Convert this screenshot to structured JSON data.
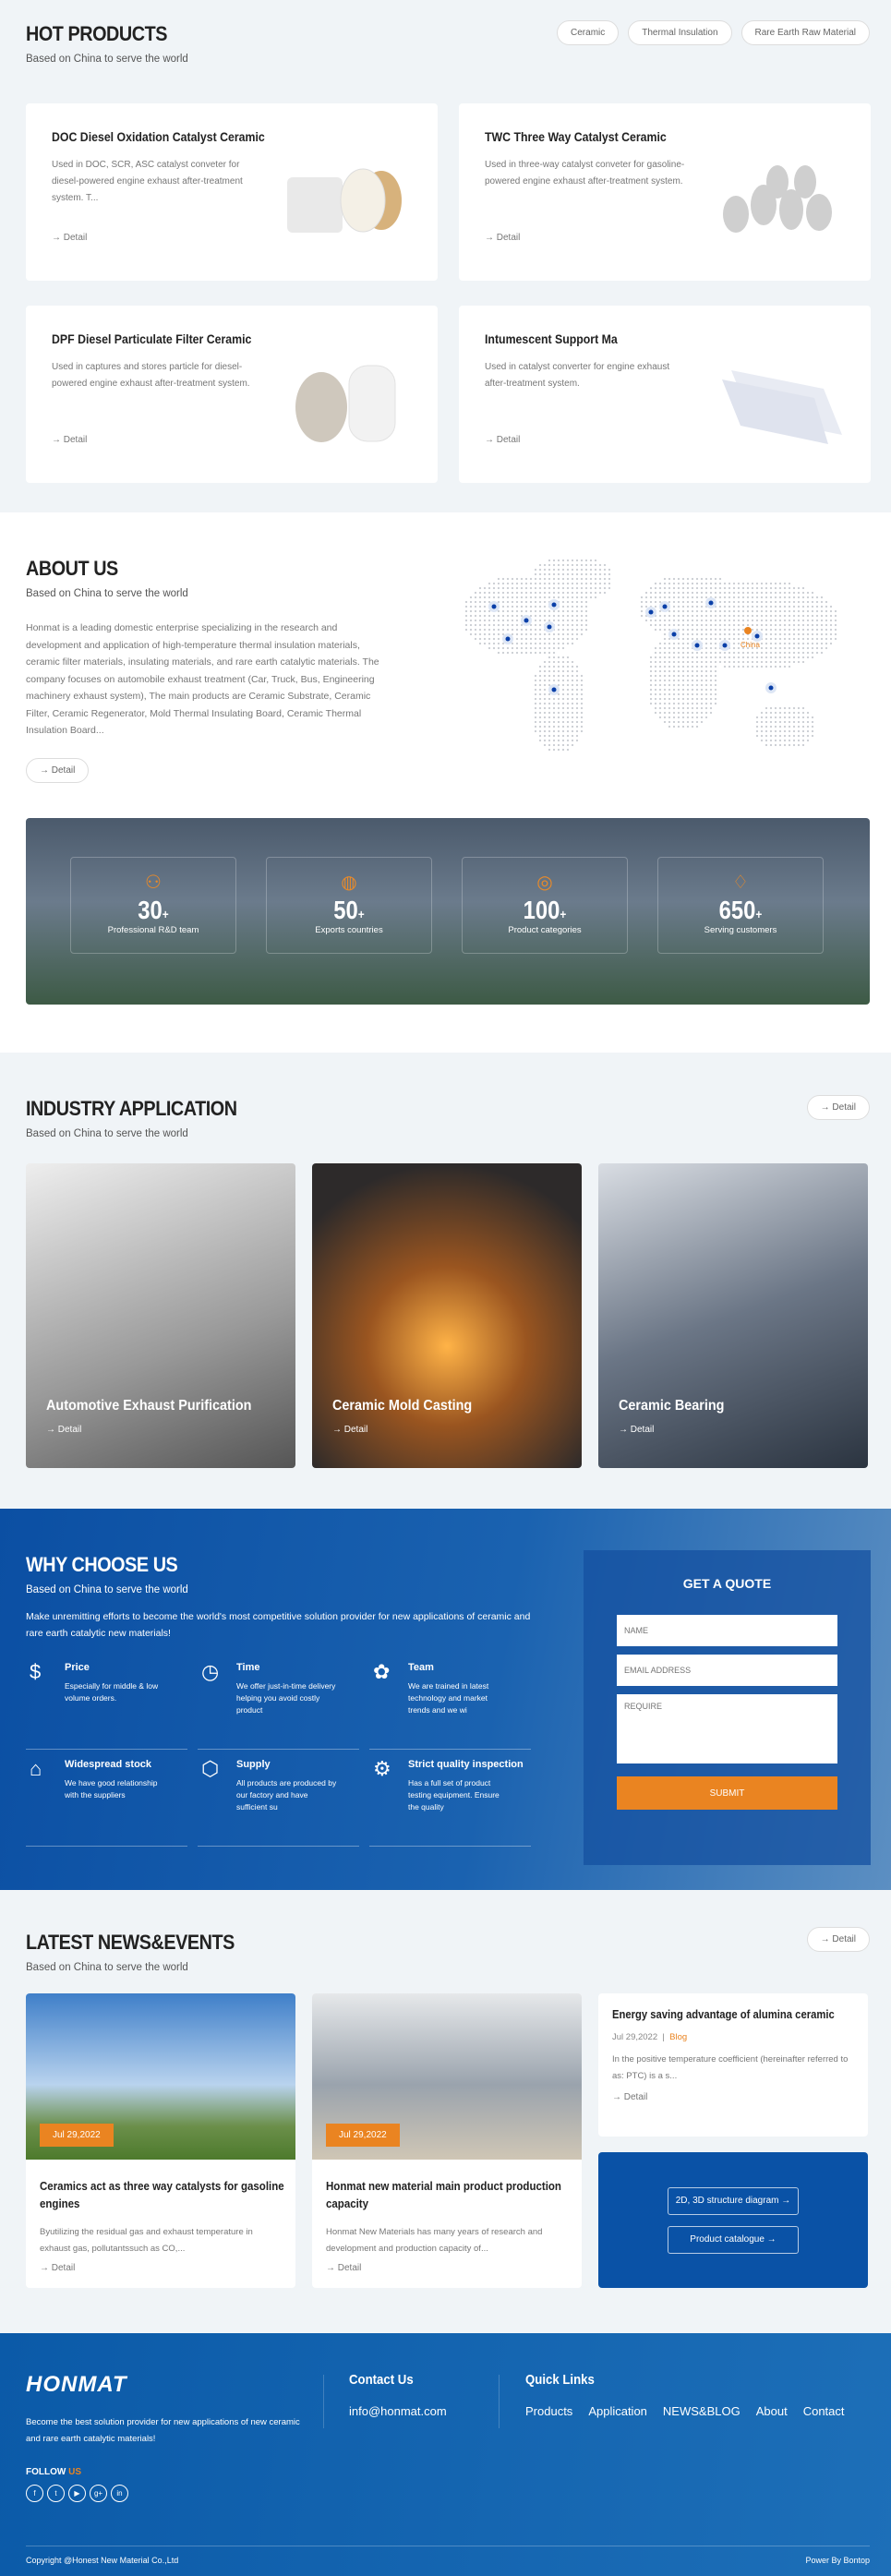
{
  "hot": {
    "title": "HOT PRODUCTS",
    "subtitle": "Based on China to serve the world",
    "tabs": [
      "Ceramic",
      "Thermal Insulation",
      "Rare Earth Raw Material"
    ],
    "products": [
      {
        "title": "DOC Diesel Oxidation Catalyst Ceramic",
        "desc": "Used in DOC, SCR, ASC catalyst conveter for diesel-powered engine exhaust after-treatment system. T...",
        "detail": "→ Detail"
      },
      {
        "title": "TWC Three Way Catalyst Ceramic",
        "desc": "Used in three-way catalyst conveter for gasoline-powered engine exhaust after-treatment system.",
        "detail": "→ Detail"
      },
      {
        "title": "DPF Diesel Particulate Filter Ceramic",
        "desc": "Used in captures and stores particle for diesel-powered engine exhaust after-treatment system.",
        "detail": "→ Detail"
      },
      {
        "title": "Intumescent Support Ma",
        "desc": "Used in catalyst converter for engine exhaust after-treatment system.",
        "detail": "→ Detail"
      }
    ]
  },
  "about": {
    "title": "ABOUT US",
    "subtitle": "Based on China to serve the world",
    "text": "Honmat is a leading domestic enterprise specializing in the research and development and application of high-temperature thermal insulation materials, ceramic filter materials, insulating materials, and rare earth catalytic materials. The company focuses on automobile exhaust treatment (Car, Truck, Bus, Engineering machinery exhaust system), The main products are Ceramic Substrate, Ceramic Filter, Ceramic Regenerator, Mold Thermal Insulating Board, Ceramic Thermal Insulation Board...",
    "detail": "→ Detail",
    "map_label": "China",
    "stats": [
      {
        "num": "30",
        "plus": "+",
        "label": "Professional R&D team",
        "icon": "team-icon"
      },
      {
        "num": "50",
        "plus": "+",
        "label": "Exports countries",
        "icon": "globe-icon"
      },
      {
        "num": "100",
        "plus": "+",
        "label": "Product categories",
        "icon": "tag-icon"
      },
      {
        "num": "650",
        "plus": "+",
        "label": "Serving customers",
        "icon": "handshake-icon"
      }
    ]
  },
  "industry": {
    "title": "INDUSTRY APPLICATION",
    "subtitle": "Based on China to serve the world",
    "detail": "→ Detail",
    "items": [
      {
        "title": "Automotive Exhaust Purification",
        "detail": "→ Detail"
      },
      {
        "title": "Ceramic Mold Casting",
        "detail": "→ Detail"
      },
      {
        "title": "Ceramic Bearing",
        "detail": "→ Detail"
      }
    ]
  },
  "why": {
    "title": "WHY CHOOSE US",
    "subtitle": "Based on China to serve the world",
    "intro": "Make unremitting efforts to become the world's most competitive solution provider for new applications of ceramic and rare earth catalytic new materials!",
    "features": [
      {
        "title": "Price",
        "text": "Especially for middle & low volume orders."
      },
      {
        "title": "Time",
        "text": "We offer just-in-time delivery helping you avoid costly product"
      },
      {
        "title": "Team",
        "text": "We are trained in latest technology and market trends and we wi"
      },
      {
        "title": "Widespread stock",
        "text": "We have good relationship with the suppliers"
      },
      {
        "title": "Supply",
        "text": "All products are produced by our factory and have sufficient su"
      },
      {
        "title": "Strict quality inspection",
        "text": "Has a full set of product testing equipment. Ensure the quality"
      }
    ],
    "quote": {
      "title": "GET A QUOTE",
      "name_ph": "NAME",
      "email_ph": "EMAIL ADDRESS",
      "require_ph": "REQUIRE",
      "submit": "SUBMIT"
    }
  },
  "news": {
    "title": "LATEST NEWS&EVENTS",
    "subtitle": "Based on China to serve the world",
    "detail": "→ Detail",
    "items": [
      {
        "date": "Jul 29,2022",
        "title": "Ceramics act as three way catalysts for gasoline engines",
        "text": "Byutilizing the residual gas and exhaust temperature in exhaust gas, pollutantssuch as CO,...",
        "detail": "→ Detail"
      },
      {
        "date": "Jul 29,2022",
        "title": "Honmat new material main product production capacity",
        "text": "Honmat New Materials has many years of research and development and production capacity of...",
        "detail": "→ Detail"
      }
    ],
    "side": {
      "title": "Energy saving advantage of alumina ceramic",
      "date": "Jul 29,2022",
      "sep": "|",
      "category": "Blog",
      "text": "In the positive temperature coefficient (hereinafter referred to as: PTC) is a s...",
      "detail": "→ Detail"
    },
    "buttons": [
      "2D, 3D structure diagram →",
      "Product catalogue →"
    ]
  },
  "footer": {
    "logo": "HONMAT",
    "tagline": "Become the best solution provider for new applications of new ceramic and rare earth catalytic materials!",
    "follow": "FOLLOW",
    "follow_accent": "US",
    "contact_title": "Contact Us",
    "email": "info@honmat.com",
    "links_title": "Quick Links",
    "links": [
      "Products",
      "Application",
      "NEWS&BLOG",
      "About",
      "Contact"
    ],
    "copyright": "Copyright @Honest New Material Co.,Ltd",
    "power": "Power By Bontop"
  },
  "colors": {
    "accent": "#ea8421",
    "brand_blue": "#0a52a6",
    "bg_light": "#f0f4f7"
  }
}
